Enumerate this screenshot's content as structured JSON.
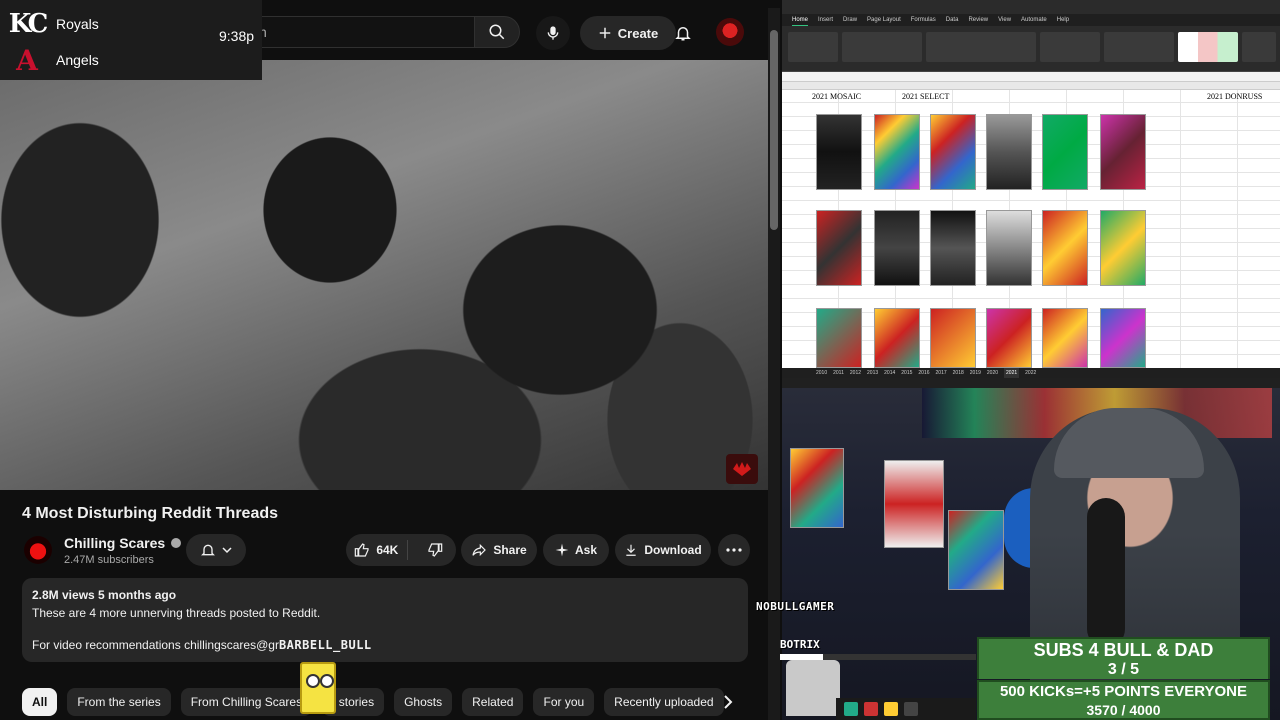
{
  "scoreboard": {
    "team1": "Royals",
    "team1_logo": "KC",
    "team2": "Angels",
    "team2_logo": "A",
    "time": "9:38p"
  },
  "youtube": {
    "search_partial": "h",
    "create_label": "Create",
    "video": {
      "title": "4 Most Disturbing Reddit Threads",
      "channel": "Chilling Scares",
      "subscribers": "2.47M subscribers",
      "likes": "64K",
      "share_label": "Share",
      "ask_label": "Ask",
      "download_label": "Download"
    },
    "description": {
      "meta": "2.8M views  5 months ago",
      "line1": "These are 4 more unnerving threads posted to Reddit.",
      "line2": "For video recommendations chillingscares@gr"
    },
    "chat_overlay": "BARBELL_BULL",
    "chips": [
      "All",
      "From the series",
      "From Chilling Scares",
      "t stories",
      "Ghosts",
      "Related",
      "For you",
      "Recently uploaded"
    ]
  },
  "excel": {
    "menu": [
      "Home",
      "Insert",
      "Draw",
      "Page Layout",
      "Formulas",
      "Data",
      "Review",
      "View",
      "Automate",
      "Help"
    ],
    "heading_left": "2021 MOSAIC",
    "heading_select": "2021 SELECT",
    "heading_right": "2021 DONRUSS",
    "sheet_tabs": [
      "2010",
      "2011",
      "2012",
      "2013",
      "2014",
      "2015",
      "2016",
      "2017",
      "2018",
      "2019",
      "2020",
      "2021",
      "2022"
    ],
    "active_tab": "2021"
  },
  "stream": {
    "chat_user": "NOBULLGAMER",
    "bot_name": "BOTRIX",
    "bot_progress": 0.22,
    "goal1_title": "SUBS 4 BULL & DAD",
    "goal1_count": "3 / 5",
    "goal1_progress": 0.6,
    "goal2_title": "500 KICKs=+5 POINTS EVERYONE",
    "goal2_count": "3570 / 4000",
    "goal2_progress": 0.8925
  },
  "colors": {
    "youtube_bg": "#0f0f0f",
    "goal_green": "#3d7f3b",
    "excel_accent": "#33c481"
  }
}
